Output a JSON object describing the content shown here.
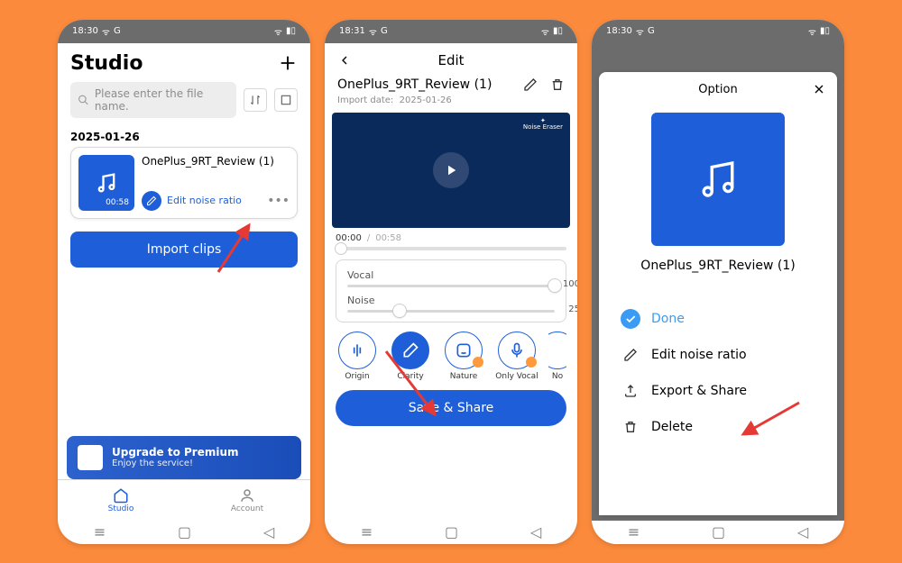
{
  "status": {
    "time1": "18:30",
    "time2": "18:31",
    "time3": "18:30",
    "net": "G"
  },
  "p1": {
    "title": "Studio",
    "search_placeholder": "Please enter the file name.",
    "date": "2025-01-26",
    "card": {
      "filename": "OnePlus_9RT_Review (1)",
      "duration": "00:58",
      "edit_label": "Edit noise ratio"
    },
    "import_btn": "Import clips",
    "premium": {
      "line1": "Upgrade to Premium",
      "line2": "Enjoy the service!"
    },
    "nav": {
      "studio": "Studio",
      "account": "Account"
    }
  },
  "p2": {
    "title": "Edit",
    "filename": "OnePlus_9RT_Review (1)",
    "import_prefix": "Import date:",
    "import_date": "2025-01-26",
    "noise_eraser": "Noise Eraser",
    "time_current": "00:00",
    "time_total": "00:58",
    "vocal_label": "Vocal",
    "vocal_value": "100",
    "noise_label": "Noise",
    "noise_value": "25",
    "modes": {
      "origin": "Origin",
      "clarity": "Clarity",
      "nature": "Nature",
      "only_vocal": "Only Vocal",
      "no": "No"
    },
    "save_btn": "Save & Share"
  },
  "p3": {
    "title": "Option",
    "filename": "OnePlus_9RT_Review (1)",
    "done": "Done",
    "edit": "Edit noise ratio",
    "export": "Export & Share",
    "delete": "Delete"
  }
}
